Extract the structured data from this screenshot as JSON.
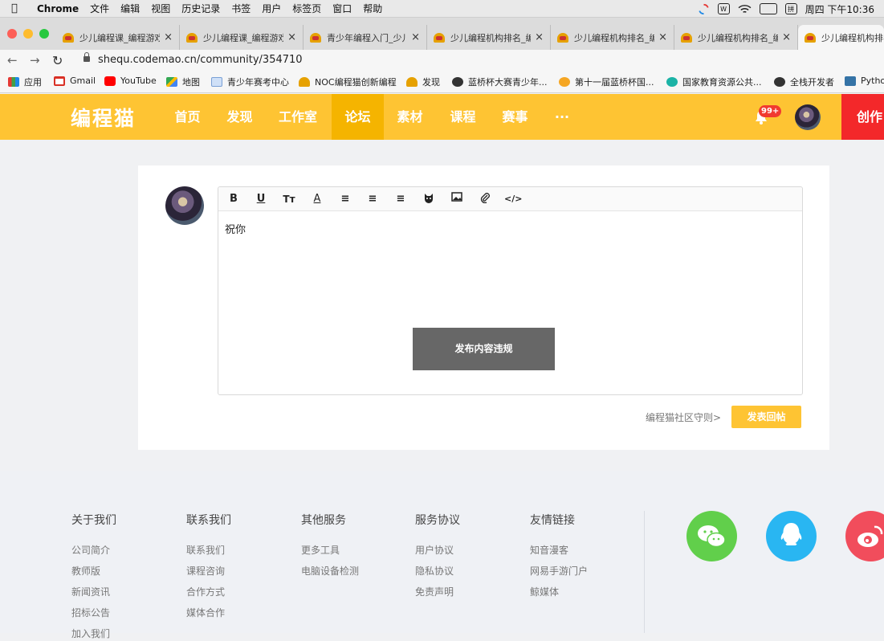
{
  "menubar": {
    "app": "Chrome",
    "items": [
      "文件",
      "编辑",
      "视图",
      "历史记录",
      "书签",
      "用户",
      "标签页",
      "窗口",
      "帮助"
    ],
    "clock": "周四 下午10:36"
  },
  "tabs": [
    {
      "title": "少儿编程课_编程游戏"
    },
    {
      "title": "少儿编程课_编程游戏"
    },
    {
      "title": "青少年编程入门_少儿"
    },
    {
      "title": "少儿编程机构排名_编"
    },
    {
      "title": "少儿编程机构排名_编"
    },
    {
      "title": "少儿编程机构排名_编"
    },
    {
      "title": "少儿编程机构排名"
    }
  ],
  "address": {
    "url": "shequ.codemao.cn/community/354710"
  },
  "bookmarks": [
    "应用",
    "Gmail",
    "YouTube",
    "地图",
    "青少年赛考中心",
    "NOC编程猫创新编程",
    "发现",
    "蓝桥杯大赛青少年...",
    "第十一届蓝桥杯国...",
    "国家教育资源公共...",
    "全栈开发者",
    "Python"
  ],
  "site": {
    "logo": "编程猫",
    "nav": [
      "首页",
      "发现",
      "工作室",
      "论坛",
      "素材",
      "课程",
      "赛事",
      "···"
    ],
    "badge": "99+",
    "create": "创作"
  },
  "editor": {
    "text": "祝你",
    "violation": "发布内容违规",
    "guide_link": "编程猫社区守则>",
    "submit": "发表回帖"
  },
  "footer": {
    "columns": [
      {
        "title": "关于我们",
        "links": [
          "公司简介",
          "教师版",
          "新闻资讯",
          "招标公告",
          "加入我们"
        ]
      },
      {
        "title": "联系我们",
        "links": [
          "联系我们",
          "课程咨询",
          "合作方式",
          "媒体合作"
        ]
      },
      {
        "title": "其他服务",
        "links": [
          "更多工具",
          "电脑设备检测"
        ]
      },
      {
        "title": "服务协议",
        "links": [
          "用户协议",
          "隐私协议",
          "免责声明"
        ]
      },
      {
        "title": "友情链接",
        "links": [
          "知音漫客",
          "网易手游门户",
          "鲸媒体"
        ]
      }
    ]
  },
  "colors": {
    "brand": "#fec433",
    "create": "#f3282a",
    "wechat": "#61cf4b",
    "qq": "#29b6f2",
    "weibo": "#f14d5c"
  }
}
